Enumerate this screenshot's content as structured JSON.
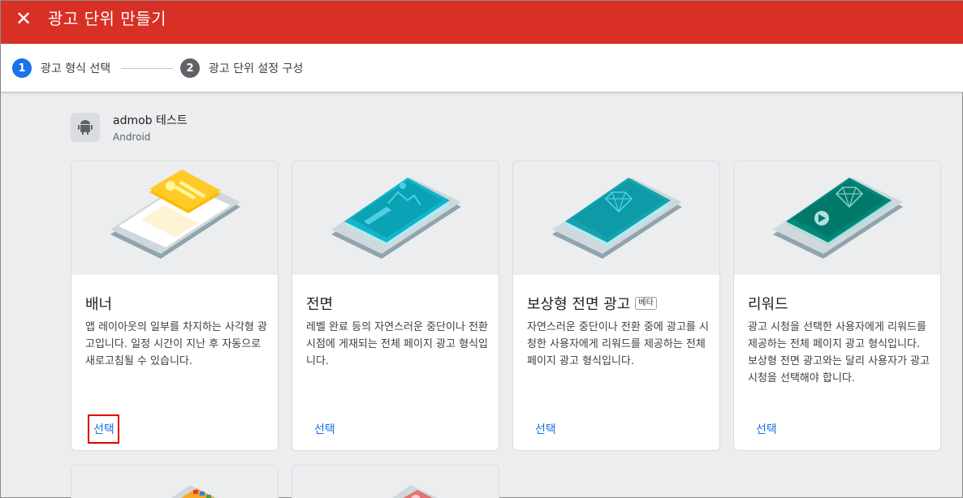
{
  "header": {
    "title": "광고 단위 만들기",
    "close_icon": "close-icon"
  },
  "stepper": {
    "steps": [
      {
        "number": "1",
        "label": "광고 형식 선택",
        "state": "active"
      },
      {
        "number": "2",
        "label": "광고 단위 설정 구성",
        "state": "inactive"
      }
    ]
  },
  "app": {
    "name": "admob 테스트",
    "platform": "Android",
    "icon": "android-icon"
  },
  "cards": [
    {
      "title": "배너",
      "badge": "",
      "description": "앱 레이아웃의 일부를 차지하는 사각형 광고입니다. 일정 시간이 지난 후 자동으로 새로고침될 수 있습니다.",
      "action": "선택",
      "accent": "#fbbc04"
    },
    {
      "title": "전면",
      "badge": "",
      "description": "레벨 완료 등의 자연스러운 중단이나 전환 시점에 게재되는 전체 페이지 광고 형식입니다.",
      "action": "선택",
      "accent": "#12b5cb"
    },
    {
      "title": "보상형 전면 광고",
      "badge": "베타",
      "description": "자연스러운 중단이나 전환 중에 광고를 시청한 사용자에게 리워드를 제공하는 전체 페이지 광고 형식입니다.",
      "action": "선택",
      "accent": "#12a4af"
    },
    {
      "title": "리워드",
      "badge": "",
      "description": "광고 시청을 선택한 사용자에게 리워드를 제공하는 전체 페이지 광고 형식입니다. 보상형 전면 광고와는 달리 사용자가 광고 시청을 선택해야 합니다.",
      "action": "선택",
      "accent": "#00897b"
    }
  ],
  "colors": {
    "header_bg": "#d93025",
    "link": "#1a73e8",
    "step_active": "#1a73e8",
    "step_inactive": "#5f6368"
  }
}
